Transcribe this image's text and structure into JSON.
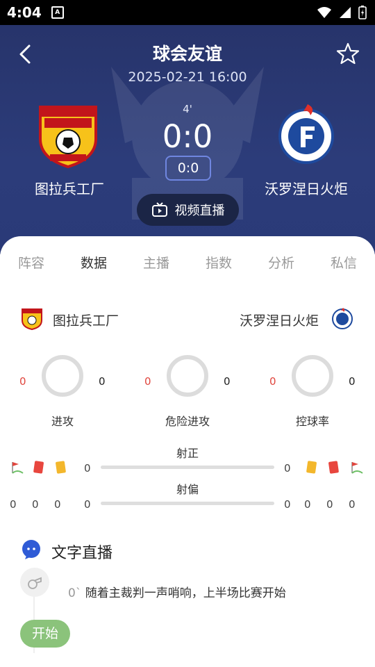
{
  "status_bar": {
    "time": "4:04",
    "notification_glyph": "A"
  },
  "header": {
    "title": "球会友谊",
    "datetime": "2025-02-21 16:00",
    "minute": "4'",
    "score": "0:0",
    "half_score": "0:0",
    "video_label": "视频直播",
    "home_team": "图拉兵工厂",
    "away_team": "沃罗涅日火炬"
  },
  "tabs": [
    "阵容",
    "数据",
    "主播",
    "指数",
    "分析",
    "私信"
  ],
  "active_tab": "数据",
  "stats": {
    "home_team": "图拉兵工厂",
    "away_team": "沃罗涅日火炬",
    "circles": [
      {
        "label": "进攻",
        "home": "0",
        "away": "0"
      },
      {
        "label": "危险进攻",
        "home": "0",
        "away": "0"
      },
      {
        "label": "控球率",
        "home": "0",
        "away": "0"
      }
    ],
    "bars": [
      {
        "label": "射正",
        "home": "0",
        "away": "0"
      },
      {
        "label": "射偏",
        "home": "0",
        "away": "0"
      }
    ],
    "home_cards": {
      "corners": "0",
      "red": "0",
      "yellow": "0"
    },
    "away_cards": {
      "yellow": "0",
      "red": "0",
      "corners": "0"
    }
  },
  "live_text": {
    "title": "文字直播",
    "events": [
      {
        "minute": "0`",
        "text": "随着主裁判一声哨响，上半场比赛开始"
      }
    ],
    "start_label": "开始"
  },
  "colors": {
    "header_bg": "#2a3a78",
    "accent_red": "#e0463e",
    "start_green": "#8bc37b"
  }
}
